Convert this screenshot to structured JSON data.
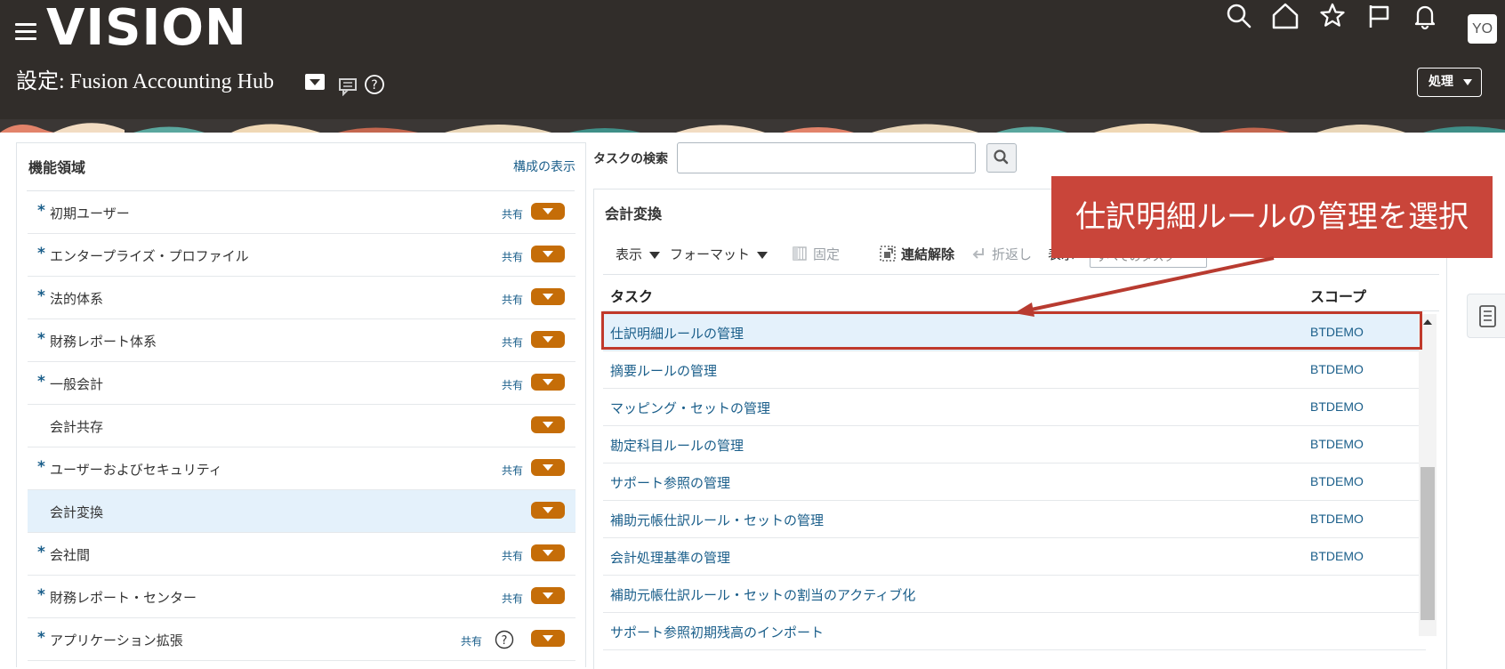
{
  "brand": {
    "logo_text": "VISION",
    "user_initials": "YO"
  },
  "header": {
    "page_title": "設定: Fusion Accounting Hub",
    "action_label": "処理"
  },
  "left_panel": {
    "title": "機能領域",
    "link_label": "構成の表示",
    "items": [
      {
        "name": "初期ユーザー",
        "required": true,
        "shared": "共有"
      },
      {
        "name": "エンタープライズ・プロファイル",
        "required": true,
        "shared": "共有"
      },
      {
        "name": "法的体系",
        "required": true,
        "shared": "共有"
      },
      {
        "name": "財務レポート体系",
        "required": true,
        "shared": "共有"
      },
      {
        "name": "一般会計",
        "required": true,
        "shared": "共有"
      },
      {
        "name": "会計共存",
        "required": false,
        "shared": ""
      },
      {
        "name": "ユーザーおよびセキュリティ",
        "required": true,
        "shared": "共有"
      },
      {
        "name": "会計変換",
        "required": false,
        "shared": "",
        "selected": true
      },
      {
        "name": "会社間",
        "required": true,
        "shared": "共有"
      },
      {
        "name": "財務レポート・センター",
        "required": true,
        "shared": "共有"
      },
      {
        "name": "アプリケーション拡張",
        "required": true,
        "shared": "共有"
      }
    ]
  },
  "task_search": {
    "label": "タスクの検索",
    "value": ""
  },
  "right_panel": {
    "title": "会計変換",
    "toolbar": {
      "view": "表示",
      "format": "フォーマット",
      "freeze": "固定",
      "detach": "連結解除",
      "wrap": "折返し",
      "show": "表示",
      "show_value": "すべてのタスク"
    },
    "columns": {
      "task": "タスク",
      "scope": "スコープ"
    },
    "rows": [
      {
        "task": "仕訳明細ルールの管理",
        "scope": "BTDEMO",
        "selected": true
      },
      {
        "task": "摘要ルールの管理",
        "scope": "BTDEMO"
      },
      {
        "task": "マッピング・セットの管理",
        "scope": "BTDEMO"
      },
      {
        "task": "勘定科目ルールの管理",
        "scope": "BTDEMO"
      },
      {
        "task": "サポート参照の管理",
        "scope": "BTDEMO"
      },
      {
        "task": "補助元帳仕訳ルール・セットの管理",
        "scope": "BTDEMO"
      },
      {
        "task": "会計処理基準の管理",
        "scope": "BTDEMO"
      },
      {
        "task": "補助元帳仕訳ルール・セットの割当のアクティブ化",
        "scope": ""
      },
      {
        "task": "サポート参照初期残高のインポート",
        "scope": ""
      }
    ]
  },
  "callout": {
    "text": "仕訳明細ルールの管理を選択"
  },
  "colors": {
    "header_bg": "#312d2a",
    "link": "#1a5e8a",
    "badge": "#c56d08",
    "callout": "#c9453a",
    "selected_row": "#e4f1fb"
  }
}
